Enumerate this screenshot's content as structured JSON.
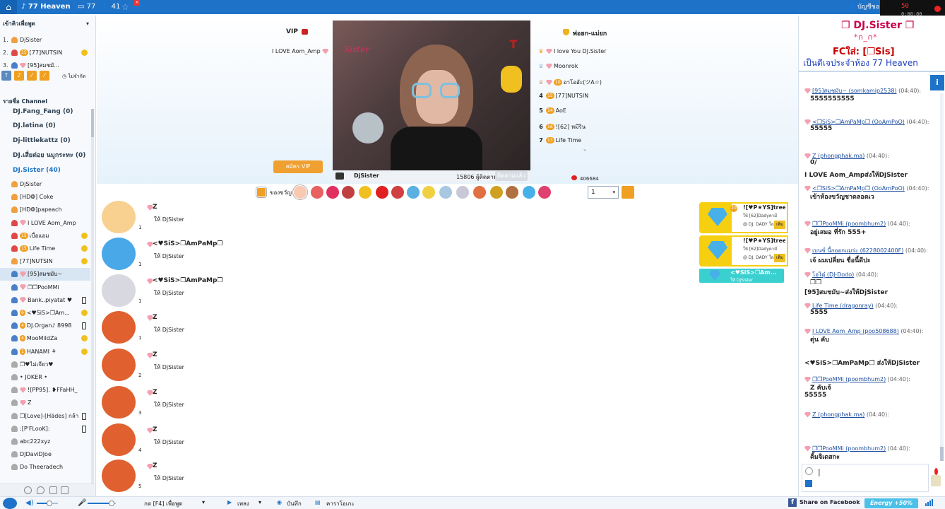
{
  "topbar": {
    "room_name": "♪ 77 Heaven",
    "count_rooms": "77",
    "count_users": "41",
    "account_label": "บัญชีของ",
    "rec_time": "50",
    "rec_clock": "0:00:00"
  },
  "left": {
    "speak_queue_label": "เข้าคิวเพื่อพูด",
    "queue": [
      {
        "n": "1.",
        "name": "DjSister"
      },
      {
        "n": "2.",
        "name": "[77]NUTSIN"
      },
      {
        "n": "3.",
        "name": "[95]สมชมั..."
      }
    ],
    "unlimited_label": "ไม่จำกัด",
    "channel_label": "รายชื่อ Channel",
    "channels": [
      {
        "name": "DJ.Fang_Fang (0)"
      },
      {
        "name": "DJ.latina (0)"
      },
      {
        "name": "Dj-littlekattz (0)"
      },
      {
        "name": "DJ.เสี่ยต่อย นมูกระทะ (0)"
      },
      {
        "name": "DJ.Sister (40)"
      }
    ],
    "members": [
      "DjSister",
      "[HD❂] Coke",
      "[HD❂]papeach",
      "I LOVE  Aom_Amp",
      "เบื่อแอม",
      "Life Time",
      "[77]NUTSIN",
      "[95]สมชมับ~",
      "❐❐PooMMi",
      "Bank..piyatat ♥",
      "<♥SiS>❐Am...",
      "DJ.Organ♪ 8998",
      "MooMildZa",
      "HANAMI ⚘",
      "❐♥ไม่เจียว♥",
      "• JOKER •",
      "![PP95]. ❥FFaHH_",
      "Z",
      "❐[Love]-[Hädes] กล้า",
      ":[P'FLooK]:",
      "abc222xyz",
      "DJDaviDJoe",
      "Do Theeradech"
    ]
  },
  "stage": {
    "vip_title": "VIP",
    "vip_user": "I LOVE  Aom_Amp",
    "vip_button": "สมัคร VIP",
    "host_name": "DjSister",
    "followers": "15806 ผู้ติดตาม",
    "follow_button": "ติดตามแล้ว",
    "video_logo_text": "Sister",
    "ranking_title": "พ่อยก-แม่ยก",
    "ranking": [
      {
        "n": "",
        "name": "I love You DJ.Sister"
      },
      {
        "n": "",
        "name": "Moonrok"
      },
      {
        "n": "",
        "name": "อาโออัะ(ツA☆)"
      },
      {
        "n": "4",
        "name": "[77]NUTSIN"
      },
      {
        "n": "5",
        "name": "AoE"
      },
      {
        "n": "6",
        "name": "![62] หมีริน"
      },
      {
        "n": "7",
        "name": "Life Time"
      }
    ],
    "ranking_more": "⌄",
    "ranking_total": "406684"
  },
  "giftbar": {
    "label": "ของขวัญ",
    "quantity": "1"
  },
  "feed": [
    {
      "user": "Z",
      "to": "ให้ DjSister",
      "count": "1"
    },
    {
      "user": "<♥SiS>❐AmPaMp❐",
      "to": "ให้ DjSister",
      "count": "1"
    },
    {
      "user": "<♥SiS>❐AmPaMp❐",
      "to": "ให้ DjSister",
      "count": "1"
    },
    {
      "user": "Z",
      "to": "ให้ DjSister",
      "count": "1"
    },
    {
      "user": "Z",
      "to": "ให้ DjSister",
      "count": "2"
    },
    {
      "user": "Z",
      "to": "ให้ DjSister",
      "count": "3"
    },
    {
      "user": "Z",
      "to": "ให้ DjSister",
      "count": "4"
    },
    {
      "user": "Z",
      "to": "ให้ DjSister",
      "count": "5"
    }
  ],
  "big_gifts": [
    {
      "n": "20",
      "who": "![♥P★YS]tree...",
      "to": "ให้ [62]Dadyคามี",
      "d": "@ DJ. DADY ใลกตี",
      "btn": "เพิ่ม"
    },
    {
      "n": "",
      "who": "![♥P★YS]tree...",
      "to": "ให้ [62]Dadyคามี",
      "d": "@ DJ. DADY ใลกตี",
      "btn": "เพิ่ม"
    }
  ],
  "small_gift": {
    "who": "<♥SiS>❐Am...",
    "to": "ให้ DjSister"
  },
  "right": {
    "banner_line1": "❐ DJ.Sister ❐",
    "banner_line2": "*∩_∩*",
    "banner_line3": "FCใส่: [❐Sis]",
    "banner_line4": "เป็นดีเจประจำห้อง 77 Heaven",
    "info": "i",
    "messages": [
      {
        "user": "[95]สมชมับ~ (somkamip2538)",
        "time": "(04:40):",
        "text": "5555555555"
      },
      {
        "user": "<❐SiS>❐AmPaMp❐ (OoAmPoO)",
        "time": "(04:40):",
        "text": "55555"
      },
      {
        "user": "Z (phongphak.ma)",
        "time": "(04:40):",
        "text": "0/"
      },
      {
        "user": "",
        "time": "",
        "text": "I LOVE  Aom_Ampส่งให้DjSister"
      },
      {
        "user": "<❐SiS>❐AmPaMp❐ (OoAmPoO)",
        "time": "(04:40):",
        "text": "เข้าห้องขวัญชาดลอดเว"
      },
      {
        "user": "❐❐PooMMi (poombhum2)",
        "time": "(04:40):",
        "text": "อยู่เสมอ ที่รัก 555+"
      },
      {
        "user": "เบนซ์ นี้กออกแมร่ะ (6228002400F)",
        "time": "(04:40):",
        "text": "เจ้ ผมเปลี่ยน ชื่อนี้ดีปะ"
      },
      {
        "user": "โอไดู๋ (DJ-Dodo)",
        "time": "(04:40):",
        "text": "❐❐"
      },
      {
        "user": "",
        "time": "",
        "text": "[95]สมชมับ~ส่งให้DjSister"
      },
      {
        "user": "Life Time (dragonray)",
        "time": "(04:40):",
        "text": "5555"
      },
      {
        "user": "I LOVE  Aom_Amp (poo508688)",
        "time": "(04:40):",
        "text": "ตุ่น คับ"
      },
      {
        "user": "",
        "time": "",
        "text": "<♥SiS>❐AmPaMp❐ ส่งให้DjSister"
      },
      {
        "user": "❐❐PooMMi (poombhum2)",
        "time": "(04:40):",
        "text": "Z คับเจ้"
      },
      {
        "user": "",
        "time": "",
        "text": "55555"
      },
      {
        "user": "Z (phongphak.ma)",
        "time": "(04:40):",
        "text": ""
      },
      {
        "user": "❐❐PooMMi (poombhum2)",
        "time": "(04:40):",
        "text": "คิ้มจิเดสกะ"
      }
    ],
    "input_cursor": "|"
  },
  "bottombar": {
    "speak_label": "กด [F4] เพื่อพูด",
    "song_label": "เพลง",
    "record_label": "บันทึก",
    "karaoke_label": "คาราโอเกะ",
    "facebook_label": "Share on Facebook",
    "energy_label": "Energy +50%",
    "volume_speaker": 0.6,
    "volume_mic": 0.85
  },
  "colors": {
    "accent": "#1e73c8",
    "gold": "#f0a020",
    "gift_yellow": "#f6d010"
  }
}
